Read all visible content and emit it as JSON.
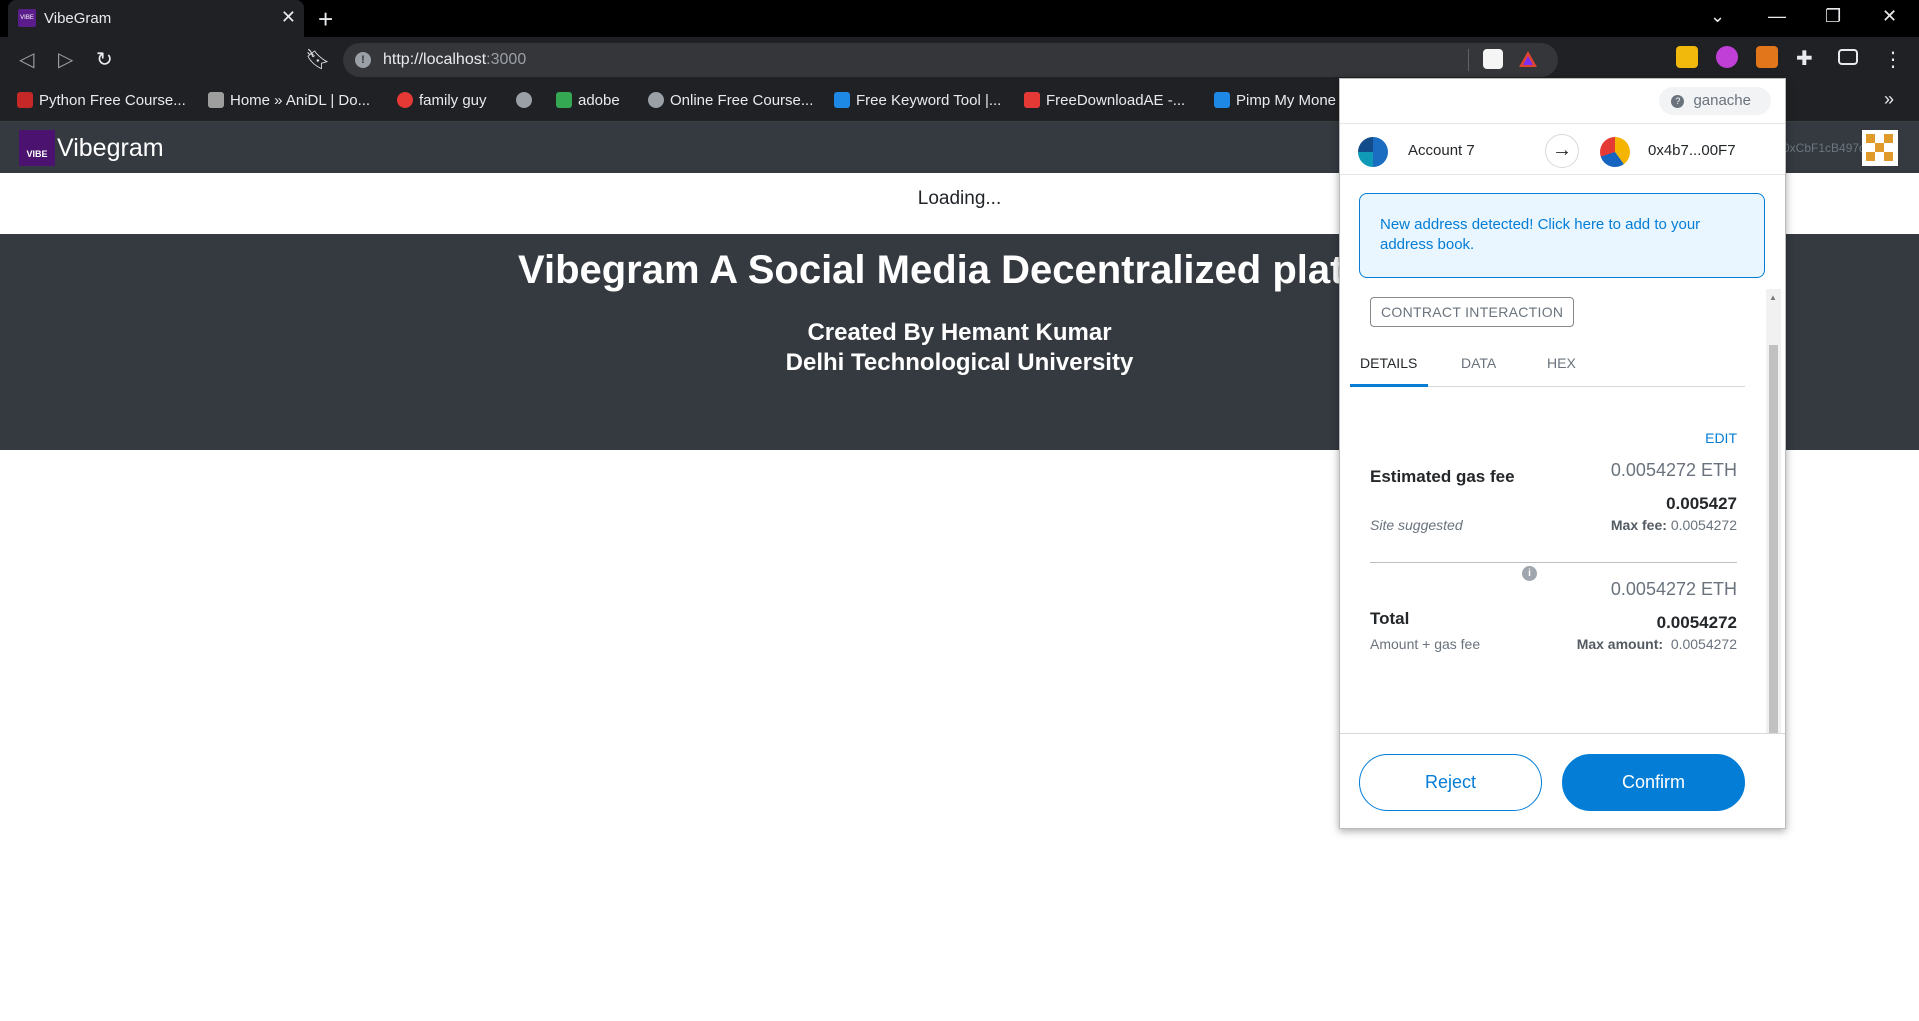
{
  "browser": {
    "tab_title": "VibeGram",
    "tab_favicon_text": "VIBE",
    "url_host": "http://localhost",
    "url_port": ":3000",
    "bookmarks": [
      {
        "label": "Python Free Course...",
        "icon": "fco-icon",
        "color": "#c62828"
      },
      {
        "label": "Home » AniDL | Do...",
        "icon": "anidl-icon",
        "color": "#9e9e9e"
      },
      {
        "label": "family guy",
        "icon": "m-icon",
        "color": "#e53935"
      },
      {
        "label": "",
        "icon": "globe-icon",
        "color": "#9aa0a6"
      },
      {
        "label": "adobe",
        "icon": "drive-icon",
        "color": "#34a853"
      },
      {
        "label": "Online Free Course...",
        "icon": "globe-icon",
        "color": "#9aa0a6"
      },
      {
        "label": "Free Keyword Tool |...",
        "icon": "wave-icon",
        "color": "#1e88e5"
      },
      {
        "label": "FreeDownloadAE -...",
        "icon": "popcorn-icon",
        "color": "#e53935"
      },
      {
        "label": "Pimp My Mone",
        "icon": "p-icon",
        "color": "#1e88e5"
      }
    ],
    "more_bookmarks": "»"
  },
  "page": {
    "brand_logo_text": "VIBE",
    "brand_name": "Vibegram",
    "account_address": "0xCbF1cB497d",
    "loading_text": "Loading...",
    "hero_title": "Vibegram A Social Media Decentralized platform",
    "hero_line1": "Created By Hemant Kumar",
    "hero_line2": "Delhi Technological University"
  },
  "metamask": {
    "network": "ganache",
    "from_account": "Account 7",
    "to_address": "0x4b7...00F7",
    "notice": "New address detected! Click here to add to your address book.",
    "contract_label": "CONTRACT INTERACTION",
    "tabs": [
      "DETAILS",
      "DATA",
      "HEX"
    ],
    "edit_label": "EDIT",
    "gas": {
      "label": "Estimated gas fee",
      "eth_value": "0.0054272 ETH",
      "value_bold": "0.005427",
      "sub_label": "Site suggested",
      "max_label": "Max fee:",
      "max_value": "0.0054272"
    },
    "total": {
      "label": "Total",
      "eth_value": "0.0054272 ETH",
      "value_bold": "0.0054272",
      "sub_label": "Amount + gas fee",
      "max_label": "Max amount:",
      "max_value": "0.0054272"
    },
    "reject_label": "Reject",
    "confirm_label": "Confirm",
    "accent_color": "#037dd6"
  }
}
